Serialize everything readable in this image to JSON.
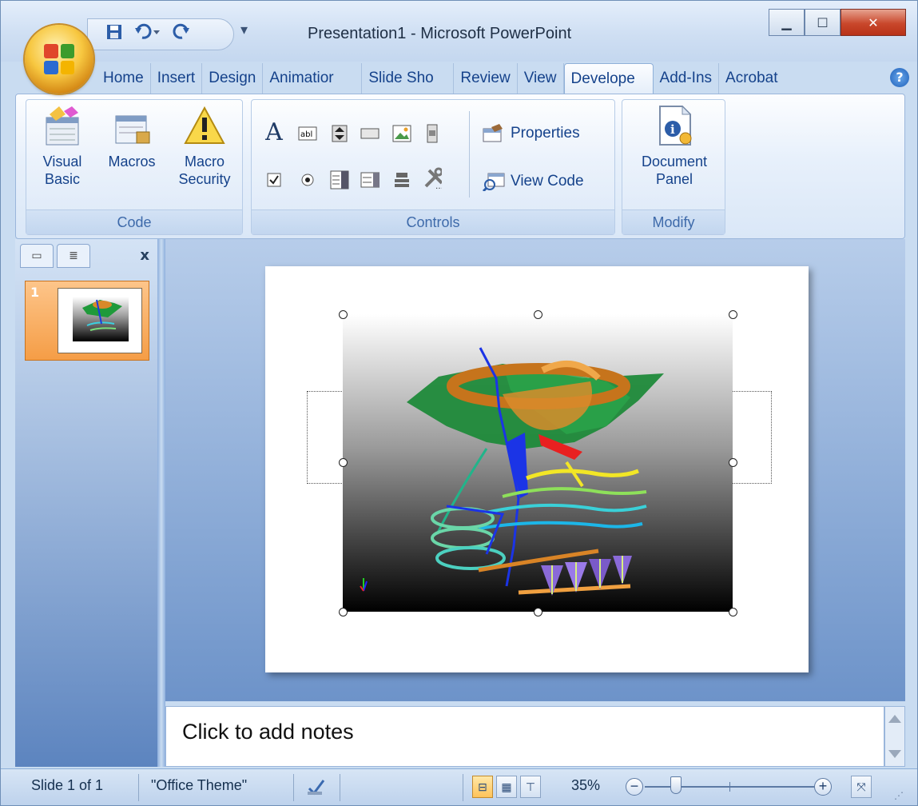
{
  "window": {
    "title": "Presentation1 - Microsoft PowerPoint"
  },
  "qat": {
    "save_icon": "save-icon",
    "undo_icon": "undo-icon",
    "redo_icon": "redo-icon"
  },
  "tabs": [
    {
      "label": "Home"
    },
    {
      "label": "Insert"
    },
    {
      "label": "Design"
    },
    {
      "label": "Animatior"
    },
    {
      "label": "Slide Sho"
    },
    {
      "label": "Review"
    },
    {
      "label": "View"
    },
    {
      "label": "Develope"
    },
    {
      "label": "Add-Ins"
    },
    {
      "label": "Acrobat"
    }
  ],
  "active_tab": "Develope",
  "ribbon": {
    "code": {
      "label": "Code",
      "visual_basic_l1": "Visual",
      "visual_basic_l2": "Basic",
      "macros": "Macros",
      "macro_security_l1": "Macro",
      "macro_security_l2": "Security"
    },
    "controls": {
      "label": "Controls",
      "properties": "Properties",
      "view_code": "View Code"
    },
    "modify": {
      "label": "Modify",
      "document_panel_l1": "Document",
      "document_panel_l2": "Panel"
    }
  },
  "slides_pane": {
    "close": "x",
    "slide_number": "1"
  },
  "notes": {
    "placeholder": "Click to add notes"
  },
  "status": {
    "slide_info": "Slide 1 of 1",
    "theme": "\"Office Theme\"",
    "zoom": "35%"
  },
  "colors": {
    "accent_active_thumb": "#f59d46",
    "ribbon_text": "#15428b",
    "close_button": "#c9472b"
  }
}
